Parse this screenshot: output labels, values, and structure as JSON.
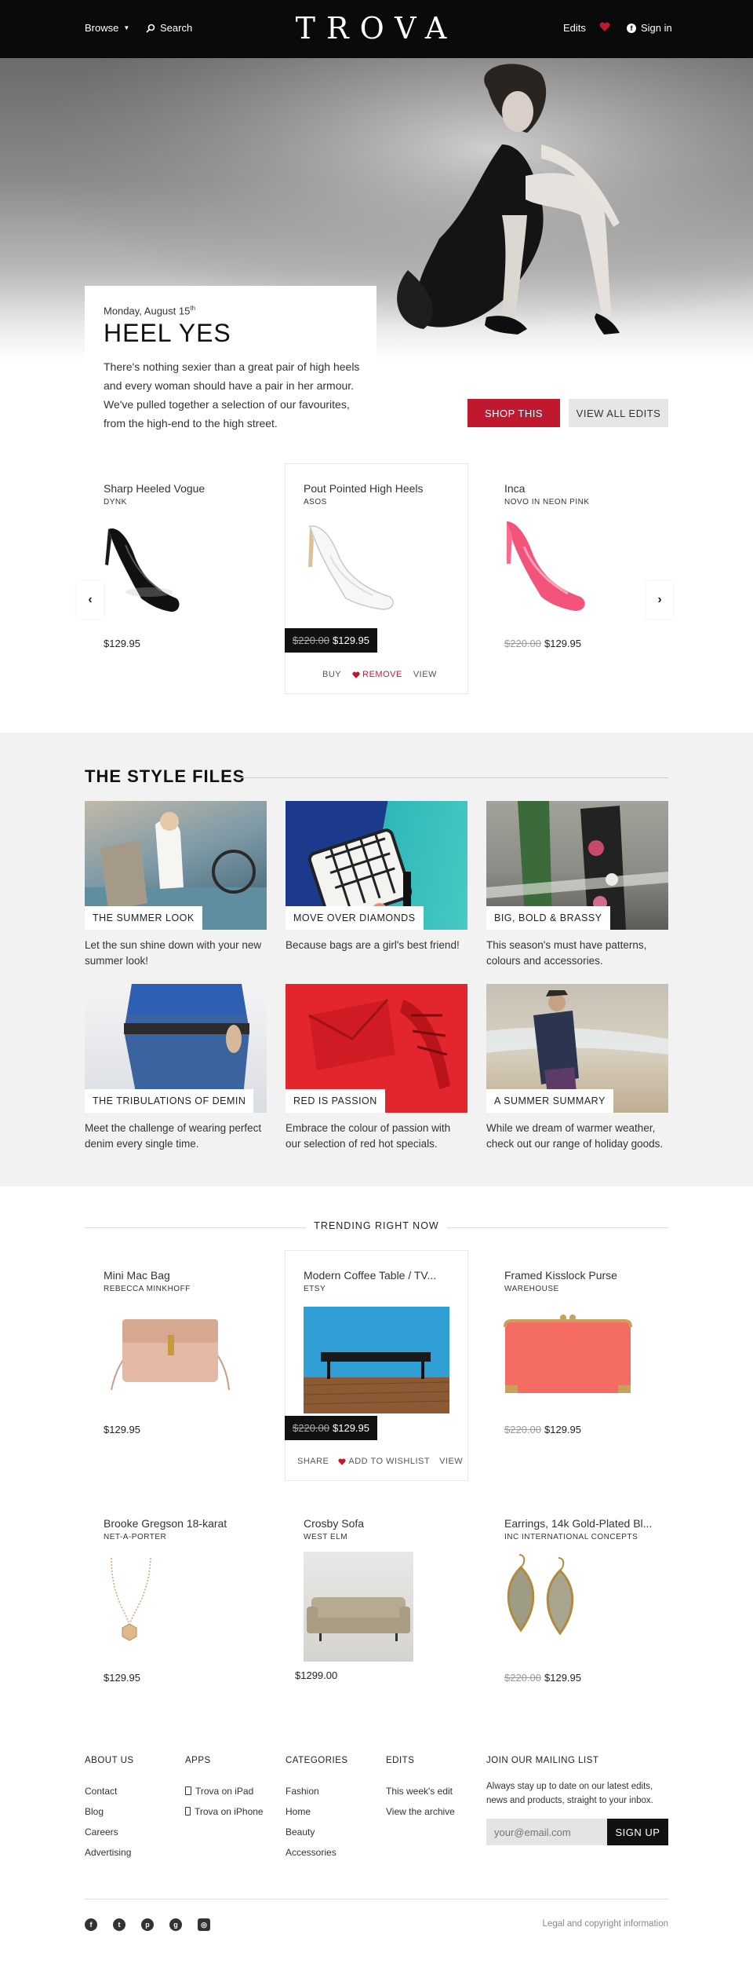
{
  "header": {
    "browse": "Browse",
    "search": "Search",
    "logo": "TROVA",
    "edits": "Edits",
    "signin": "Sign in"
  },
  "feature": {
    "date": "Monday, August 15",
    "date_sup": "th",
    "title": "HEEL YES",
    "intro": "There's nothing sexier than a great pair of high heels and every woman should have a pair in her armour. We've pulled together a selection of our favourites, from the high-end to the high street.",
    "shop_label": "SHOP THIS",
    "view_all_label": "VIEW ALL EDITS"
  },
  "products": [
    {
      "name": "Sharp Heeled Vogue",
      "brand": "DYNK",
      "old_price": "",
      "price": "$129.95"
    },
    {
      "name": "Pout Pointed High Heels",
      "brand": "ASOS",
      "old_price": "$220.00",
      "price": "$129.95"
    },
    {
      "name": "Inca",
      "brand": "NOVO IN NEON PINK",
      "old_price": "$220.00",
      "price": "$129.95"
    }
  ],
  "product_actions": {
    "buy": "BUY",
    "remove": "REMOVE",
    "view": "VIEW"
  },
  "style_files": {
    "title": "THE STYLE FILES",
    "items": [
      {
        "label": "THE SUMMER LOOK",
        "desc": "Let the sun shine down with your new summer look!"
      },
      {
        "label": "MOVE OVER DIAMONDS",
        "desc": "Because bags are a girl's best friend!"
      },
      {
        "label": "BIG, BOLD & BRASSY",
        "desc": "This season's must have patterns, colours and accessories."
      },
      {
        "label": "THE TRIBULATIONS OF DEMIN",
        "desc": "Meet the challenge of wearing perfect denim every single time."
      },
      {
        "label": "RED IS PASSION",
        "desc": "Embrace the colour of passion with our selection of red hot specials."
      },
      {
        "label": "A SUMMER SUMMARY",
        "desc": "While we dream of warmer weather, check out our range of holiday goods."
      }
    ]
  },
  "trending": {
    "title": "TRENDING RIGHT NOW",
    "actions": {
      "share": "SHARE",
      "wishlist": "ADD TO WISHLIST",
      "view": "VIEW"
    },
    "items": [
      {
        "name": "Mini Mac Bag",
        "brand": "REBECCA MINKHOFF",
        "old_price": "",
        "price": "$129.95"
      },
      {
        "name": "Modern Coffee Table / TV...",
        "brand": "ETSY",
        "old_price": "$220.00",
        "price": "$129.95"
      },
      {
        "name": "Framed Kisslock Purse",
        "brand": "WAREHOUSE",
        "old_price": "$220.00",
        "price": "$129.95"
      },
      {
        "name": "Brooke Gregson 18-karat",
        "brand": "NET-A-PORTER",
        "old_price": "",
        "price": "$129.95"
      },
      {
        "name": "Crosby Sofa",
        "brand": "WEST ELM",
        "old_price": "",
        "price": "$1299.00"
      },
      {
        "name": "Earrings, 14k Gold-Plated Bl...",
        "brand": "INC INTERNATIONAL CONCEPTS",
        "old_price": "$220.00",
        "price": "$129.95"
      }
    ]
  },
  "footer": {
    "about": {
      "title": "ABOUT US",
      "links": [
        "Contact",
        "Blog",
        "Careers",
        "Advertising"
      ]
    },
    "apps": {
      "title": "APPS",
      "links": [
        "Trova on iPad",
        "Trova on iPhone"
      ]
    },
    "categories": {
      "title": "CATEGORIES",
      "links": [
        "Fashion",
        "Home",
        "Beauty",
        "Accessories"
      ]
    },
    "edits": {
      "title": "EDITS",
      "links": [
        "This week's edit",
        "View the archive"
      ]
    },
    "mailing": {
      "title": "JOIN OUR MAILING LIST",
      "text": "Always stay up to date on our latest edits, news and products, straight to your inbox.",
      "placeholder": "your@email.com",
      "button": "SIGN UP"
    },
    "legal": "Legal and copyright information",
    "social_icons": [
      "facebook-icon",
      "twitter-icon",
      "pinterest-icon",
      "googleplus-icon",
      "instagram-icon"
    ]
  },
  "colors": {
    "accent": "#c0192f",
    "dark": "#0a0a0a",
    "band": "#f2f2f2"
  }
}
